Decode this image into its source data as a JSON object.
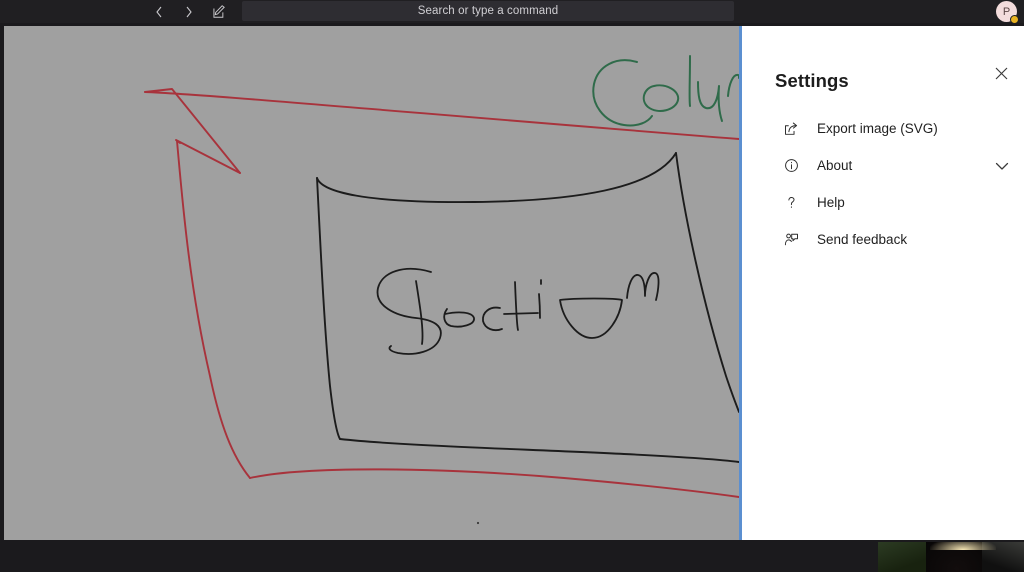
{
  "topbar": {
    "back_icon": "chevron-left-icon",
    "forward_icon": "chevron-right-icon",
    "compose_icon": "compose-note-icon",
    "search_placeholder": "Search or type a command",
    "search_value": "",
    "avatar_initial": "P",
    "avatar_badge_color": "#e9b321",
    "background_color": "#201f22"
  },
  "canvas": {
    "background_color": "#a0a0a0",
    "divider_color": "#5b8fd0",
    "ink": [
      {
        "label": "Colum",
        "kind": "handwriting",
        "color": "#2f6b4a",
        "note": "green handwritten word partially hidden behind settings panel"
      },
      {
        "label": "Section",
        "kind": "handwriting",
        "color": "#1c1c1c",
        "note": "black handwritten word inside the drawn box"
      },
      {
        "label": "box",
        "kind": "shape",
        "color": "#1c1c1c",
        "note": "hand drawn rectangle / section outline"
      },
      {
        "label": "red-selection-stroke",
        "kind": "shape",
        "color": "#a8333c",
        "note": "red lasso-like annotation strokes around the content"
      }
    ]
  },
  "settings_panel": {
    "title": "Settings",
    "close_icon": "close-icon",
    "background_color": "#ffffff",
    "items": [
      {
        "label": "Export image (SVG)",
        "icon": "share-export-icon",
        "has_chevron": false
      },
      {
        "label": "About",
        "icon": "info-circle-icon",
        "has_chevron": true,
        "chevron_icon": "chevron-down-icon"
      },
      {
        "label": "Help",
        "icon": "question-mark-icon",
        "has_chevron": false
      },
      {
        "label": "Send feedback",
        "icon": "send-feedback-icon",
        "has_chevron": false
      }
    ]
  },
  "bottom": {
    "background_color": "#1b1a1d",
    "video_thumbnail": "webcam-video-thumbnail"
  }
}
